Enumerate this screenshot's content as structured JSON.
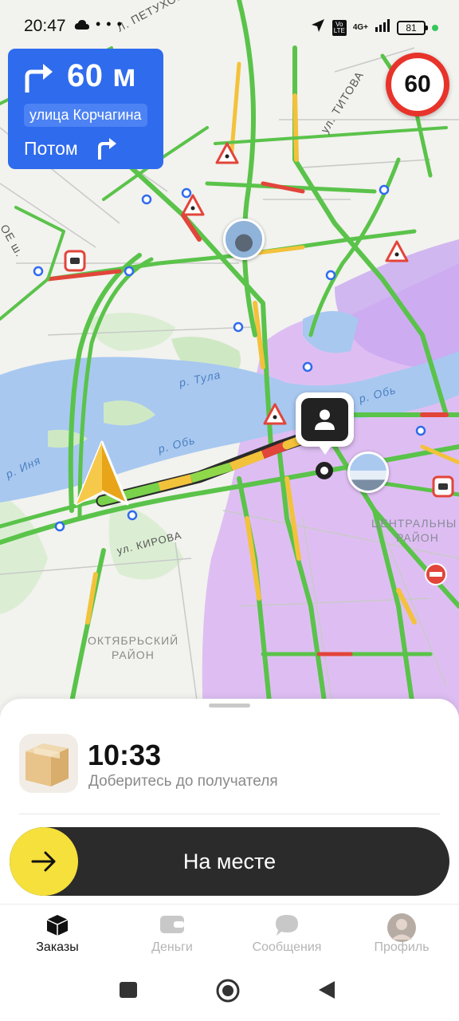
{
  "status_bar": {
    "time": "20:47",
    "dots": "• • •",
    "volte_line1": "Vo",
    "volte_line2": "LTE",
    "network": "4G+",
    "battery": "81"
  },
  "navigation": {
    "distance": "60 м",
    "street": "улица Корчагина",
    "then_label": "Потом"
  },
  "speed_limit": "60",
  "map_labels": {
    "petukhova": "Л. ПЕТУХОВА",
    "titova": "ул. ТИТОВА",
    "sh": "ОЕ ш.",
    "tula": "р. Тула",
    "ob1": "р. Обь",
    "ob2": "р. Обь",
    "inya": "р. Иня",
    "kirova": "ул. КИРОВА",
    "central_1": "ЦЕНТРАЛЬНЫ",
    "central_2": "РАЙОН",
    "oktyabrsky_1": "ОКТЯБРЬСКИЙ",
    "oktyabrsky_2": "РАЙОН"
  },
  "order": {
    "eta": "10:33",
    "subtitle": "Доберитесь до получателя",
    "button_label": "На месте"
  },
  "tabs": [
    {
      "label": "Заказы",
      "icon": "box-icon"
    },
    {
      "label": "Деньги",
      "icon": "wallet-icon"
    },
    {
      "label": "Сообщения",
      "icon": "chat-icon"
    },
    {
      "label": "Профиль",
      "icon": "avatar"
    }
  ],
  "colors": {
    "nav_blue": "#2f6bed",
    "accent_yellow": "#f5e03c",
    "traffic_green": "#5ac34a",
    "traffic_yellow": "#f3c23b",
    "traffic_red": "#e2453a",
    "river": "#a8c8f0",
    "district_purple": "#d9b6f0"
  }
}
